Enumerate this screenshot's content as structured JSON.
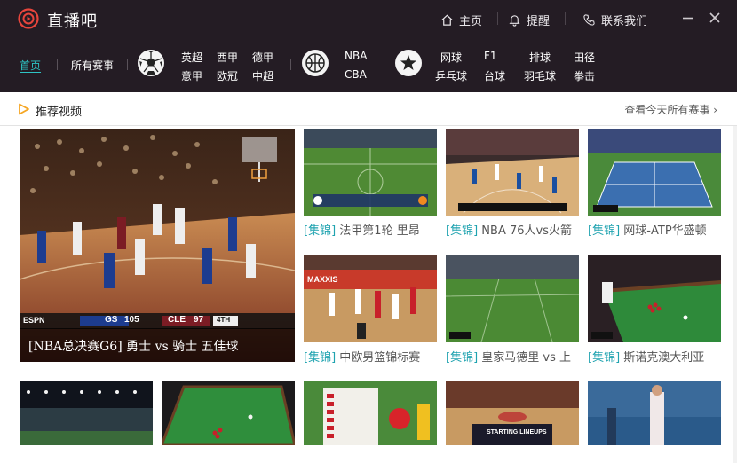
{
  "app": {
    "title": "直播吧",
    "colors": {
      "titlebar_bg": "#241c24",
      "accent": "#2ec4c4",
      "tag": "#1fa3b0",
      "play_icon": "#f5a623"
    }
  },
  "topnav": {
    "home": {
      "label": "主页",
      "icon": "home-icon"
    },
    "remind": {
      "label": "提醒",
      "icon": "bell-icon"
    },
    "contact": {
      "label": "联系我们",
      "icon": "phone-icon"
    }
  },
  "nav": {
    "home": "首页",
    "all": "所有赛事",
    "football": [
      "英超",
      "西甲",
      "德甲",
      "意甲",
      "欧冠",
      "中超"
    ],
    "basketball": [
      "NBA",
      "CBA"
    ],
    "other": [
      "网球",
      "F1",
      "排球",
      "田径",
      "乒乓球",
      "台球",
      "羽毛球",
      "拳击"
    ]
  },
  "section": {
    "title": "推荐视频",
    "see_all": "查看今天所有赛事 ›"
  },
  "videos": {
    "hero": {
      "caption": "[NBA总决赛G6] 勇士 vs 骑士 五佳球",
      "score_left": "GS",
      "score_home": "105",
      "score_away": "97",
      "score_right": "CLE",
      "quarter": "4TH"
    },
    "items": [
      {
        "tag": "[集锦]",
        "title": "法甲第1轮 里昂"
      },
      {
        "tag": "[集锦]",
        "title": "NBA 76人vs火箭"
      },
      {
        "tag": "[集锦]",
        "title": "网球-ATP华盛顿"
      },
      {
        "tag": "[集锦]",
        "title": "中欧男篮锦标赛"
      },
      {
        "tag": "[集锦]",
        "title": "皇家马德里 vs 上"
      },
      {
        "tag": "[集锦]",
        "title": "斯诺克澳大利亚"
      }
    ],
    "overlays": {
      "lineups": "STARTING LINEUPS",
      "maxxis": "MAXXIS"
    }
  }
}
